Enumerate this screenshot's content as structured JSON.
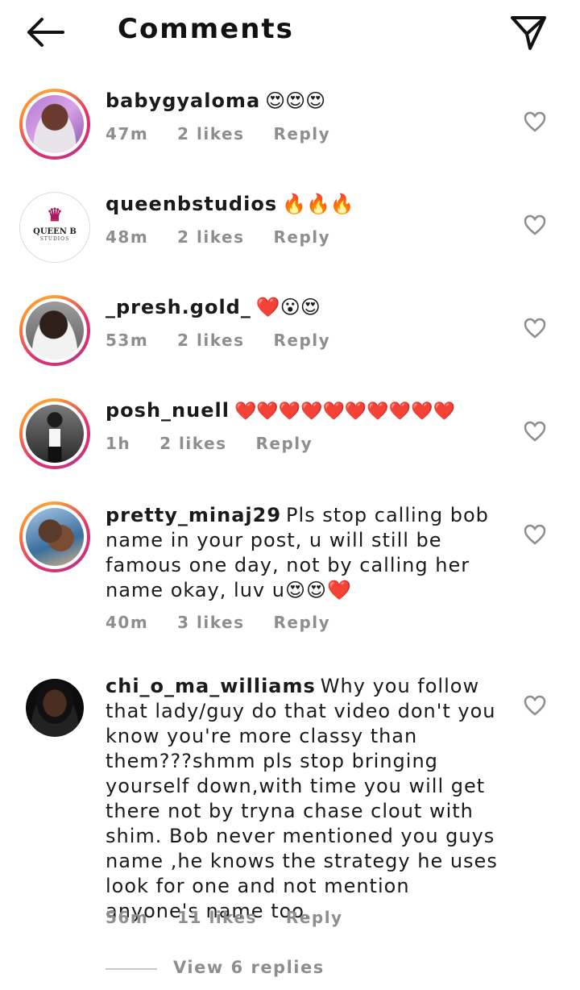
{
  "header": {
    "title": "Comments",
    "back_icon": "back-arrow-icon",
    "send_icon": "paper-plane-icon"
  },
  "comments": [
    {
      "username": "babygyaloma",
      "text": "😍😍😍",
      "time": "47m",
      "likes": "2 likes",
      "reply": "Reply",
      "has_story_ring": true
    },
    {
      "username": "queenbstudios",
      "text": "🔥🔥🔥",
      "time": "48m",
      "likes": "2 likes",
      "reply": "Reply",
      "has_story_ring": false,
      "logo_text": "QUEEN B",
      "logo_subtext": "STUDIOS"
    },
    {
      "username": "_presh.gold_",
      "text": "❤️😮😍",
      "time": "53m",
      "likes": "2 likes",
      "reply": "Reply",
      "has_story_ring": true
    },
    {
      "username": "posh_nuell",
      "text": "❤️❤️❤️❤️❤️❤️❤️❤️❤️❤️",
      "time": "1h",
      "likes": "2 likes",
      "reply": "Reply",
      "has_story_ring": true
    },
    {
      "username": "pretty_minaj29",
      "text": "Pls stop calling bob name in your post, u will still be famous one day, not by calling her name okay, luv u😍😍❤️",
      "time": "40m",
      "likes": "3 likes",
      "reply": "Reply",
      "has_story_ring": true
    },
    {
      "username": "chi_o_ma_williams",
      "text": "Why you follow that lady/guy do that video don't you know you're more classy than them???shmm pls stop bringing yourself down,with time you will get there not by tryna chase clout with shim. Bob never mentioned you guys name ,he knows the strategy he uses look for one and not mention anyone's name too.",
      "time": "56m",
      "likes": "11 likes",
      "reply": "Reply",
      "has_story_ring": false
    }
  ],
  "view_replies": "View 6 replies",
  "colors": {
    "text": "#1a1a1a",
    "meta": "#8e8e8e",
    "ring_start": "#f8a13b",
    "ring_end": "#c13584"
  }
}
